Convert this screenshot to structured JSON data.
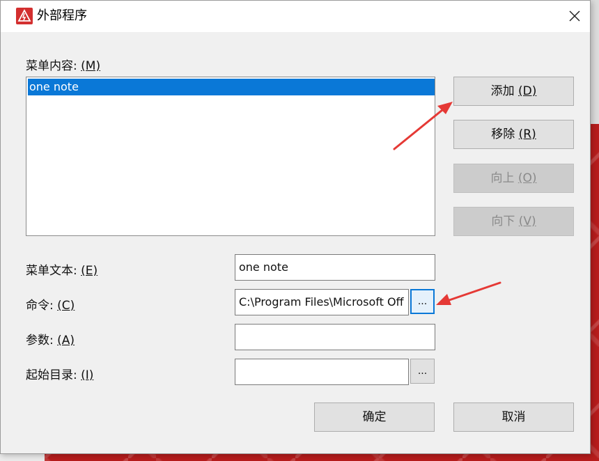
{
  "window": {
    "title": "外部程序"
  },
  "menu_contents": {
    "label": "菜单内容:",
    "mnemonic": "(M)",
    "items": [
      "one note"
    ]
  },
  "buttons": {
    "add": {
      "label": "添加",
      "mnemonic": "(D)"
    },
    "remove": {
      "label": "移除",
      "mnemonic": "(R)"
    },
    "move_up": {
      "label": "向上",
      "mnemonic": "(O)"
    },
    "move_down": {
      "label": "向下",
      "mnemonic": "(V)"
    },
    "ok": "确定",
    "cancel": "取消",
    "browse": "..."
  },
  "fields": {
    "menu_text": {
      "label": "菜单文本:",
      "mnemonic": "(E)",
      "value": "one note"
    },
    "command": {
      "label": "命令:",
      "mnemonic": "(C)",
      "value": "C:\\Program Files\\Microsoft Off"
    },
    "arguments": {
      "label": "参数:",
      "mnemonic": "(A)",
      "value": ""
    },
    "initial_dir": {
      "label": "起始目录:",
      "mnemonic": "(I)",
      "value": ""
    }
  },
  "colors": {
    "selection": "#0a78d7",
    "annotation_arrow": "#e53935",
    "app_icon": "#d32f2f"
  }
}
